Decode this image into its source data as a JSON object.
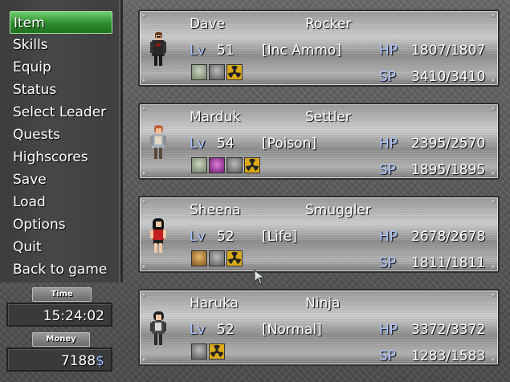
{
  "menu": {
    "items": [
      {
        "label": "Item",
        "selected": true
      },
      {
        "label": "Skills",
        "selected": false
      },
      {
        "label": "Equip",
        "selected": false
      },
      {
        "label": "Status",
        "selected": false
      },
      {
        "label": "Select Leader",
        "selected": false
      },
      {
        "label": "Quests",
        "selected": false
      },
      {
        "label": "Highscores",
        "selected": false
      },
      {
        "label": "Save",
        "selected": false
      },
      {
        "label": "Load",
        "selected": false
      },
      {
        "label": "Options",
        "selected": false
      },
      {
        "label": "Quit",
        "selected": false
      },
      {
        "label": "Back to game",
        "selected": false
      }
    ]
  },
  "time": {
    "label": "Time elapsed",
    "value": "15:24:02"
  },
  "money": {
    "label": "Money",
    "value": "7188",
    "currency": "$"
  },
  "party": [
    {
      "name": "Dave",
      "class": "Rocker",
      "lv_label": "Lv",
      "level": "51",
      "ammo": "[Inc Ammo]",
      "hp_label": "HP",
      "hp": "1807/1807",
      "sp_label": "SP",
      "sp": "3410/3410",
      "status_icons": [
        "green",
        "grey",
        "radiation"
      ]
    },
    {
      "name": "Marduk",
      "class": "Settler",
      "lv_label": "Lv",
      "level": "54",
      "ammo": "[Poison]",
      "hp_label": "HP",
      "hp": "2395/2570",
      "sp_label": "SP",
      "sp": "1895/1895",
      "status_icons": [
        "green",
        "purple",
        "grey",
        "radiation"
      ]
    },
    {
      "name": "Sheena",
      "class": "Smuggler",
      "lv_label": "Lv",
      "level": "52",
      "ammo": "[Life]",
      "hp_label": "HP",
      "hp": "2678/2678",
      "sp_label": "SP",
      "sp": "1811/1811",
      "status_icons": [
        "bronze",
        "grey",
        "radiation"
      ]
    },
    {
      "name": "Haruka",
      "class": "Ninja",
      "lv_label": "Lv",
      "level": "52",
      "ammo": "[Normal]",
      "hp_label": "HP",
      "hp": "3372/3372",
      "sp_label": "SP",
      "sp": "1283/1583",
      "status_icons": [
        "grey",
        "radiation"
      ]
    }
  ],
  "colors": {
    "selected_menu": "#2c8a2c",
    "stat_label": "#a8c4ff",
    "text": "#ffffff"
  }
}
